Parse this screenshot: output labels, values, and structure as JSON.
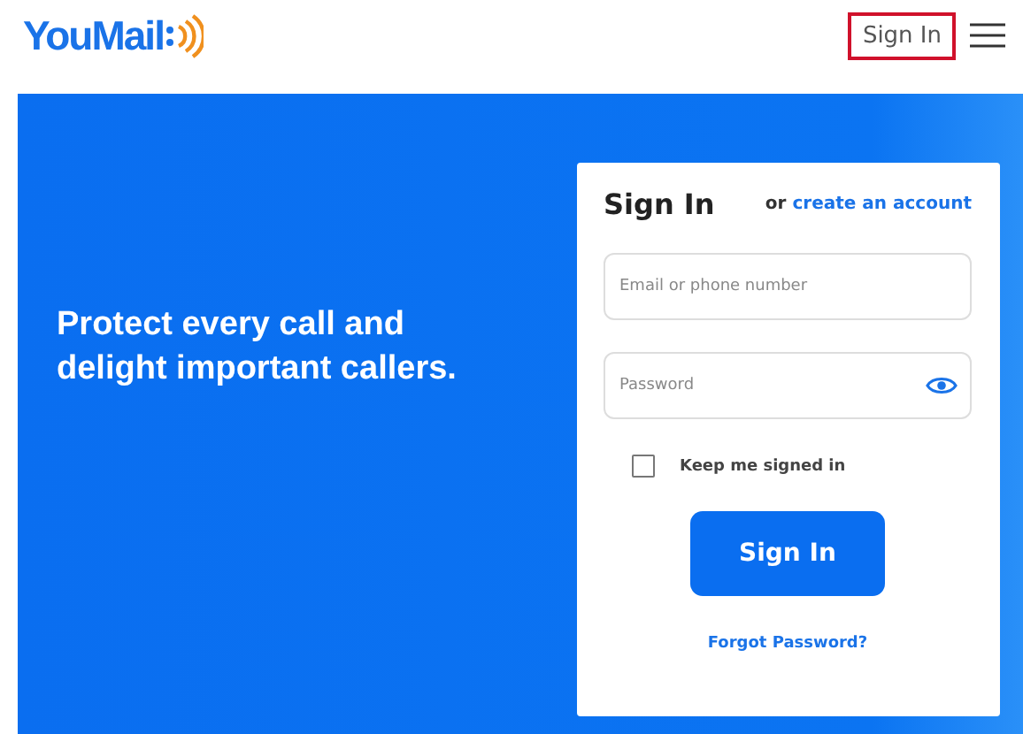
{
  "header": {
    "logo": "YouMail",
    "nav_link": {
      "label": "Sign In",
      "highlighted": true
    }
  },
  "hero": {
    "tagline": "Protect every call and delight important callers."
  },
  "sign_in_card": {
    "title": "Sign In",
    "or_text": "or",
    "create_link": "create an account",
    "email_field": {
      "placeholder": "Email or phone number"
    },
    "password_field": {
      "placeholder": "Password"
    },
    "keep_signed_in": {
      "label": "Keep me signed in",
      "checked": false
    },
    "submit_button": "Sign In",
    "forgot_link": "Forgot Password?"
  }
}
